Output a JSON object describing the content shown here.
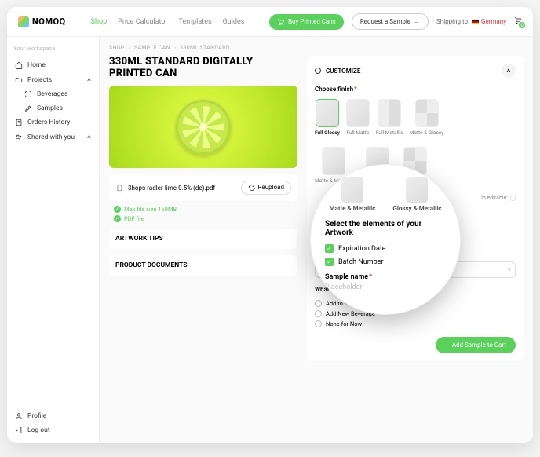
{
  "brand": "NOMOQ",
  "nav": {
    "shop": "Shop",
    "pricecalc": "Price Calculator",
    "templates": "Templates",
    "guides": "Guides"
  },
  "header": {
    "buy": "Buy Printed Cans",
    "sample": "Request a Sample",
    "ship_label": "Shipping to:",
    "ship_country": "Germany",
    "cart_count": "0"
  },
  "sidebar": {
    "workspace": "Your workspace",
    "home": "Home",
    "projects": "Projects",
    "beverages": "Beverages",
    "samples": "Samples",
    "orders": "Orders History",
    "shared": "Shared with you",
    "profile": "Profile",
    "logout": "Log out"
  },
  "crumbs": {
    "a": "SHOP",
    "b": "SAMPLE CAN",
    "c": "330ML STANDARD"
  },
  "product": {
    "title": "330ML STANDARD DIGITALLY PRINTED CAN",
    "filename": "3hops-radler-lime-0.5% (de).pdf",
    "reupload": "Reupload",
    "hint_size": "Max file size 150MB",
    "hint_pdf": "PDF file"
  },
  "sections": {
    "tips": "ARTWORK TIPS",
    "docs": "PRODUCT DOCUMENTS"
  },
  "customize": {
    "head": "CUSTOMIZE",
    "finish_label": "Choose finish",
    "finishes": {
      "glossy": "Full Glossy",
      "matte": "Full Matte",
      "metallic": "Full Metallic",
      "mg": "Matte & Glossy",
      "mm": "Matte & Metallic",
      "gm": "Glossy & Metallic",
      "all": "Matte &"
    },
    "editable_note": "in editable:",
    "sample_name": "Sample name",
    "placeholder": "Placeholder",
    "bev_q": "What beverage will you use this can for?",
    "opt1": "Add to an Existing Beverage",
    "opt2": "Add New Beverage",
    "opt3": "None for Now",
    "add_btn": "Add Sample to Cart"
  },
  "magnifier": {
    "fin1": "Matte & Metallic",
    "fin2": "Glossy & Metallic",
    "title": "Select the elements of your Artwork",
    "exp": "Expiration Date",
    "batch": "Batch Number",
    "sample": "Sample name",
    "ph": "Placeholder"
  }
}
